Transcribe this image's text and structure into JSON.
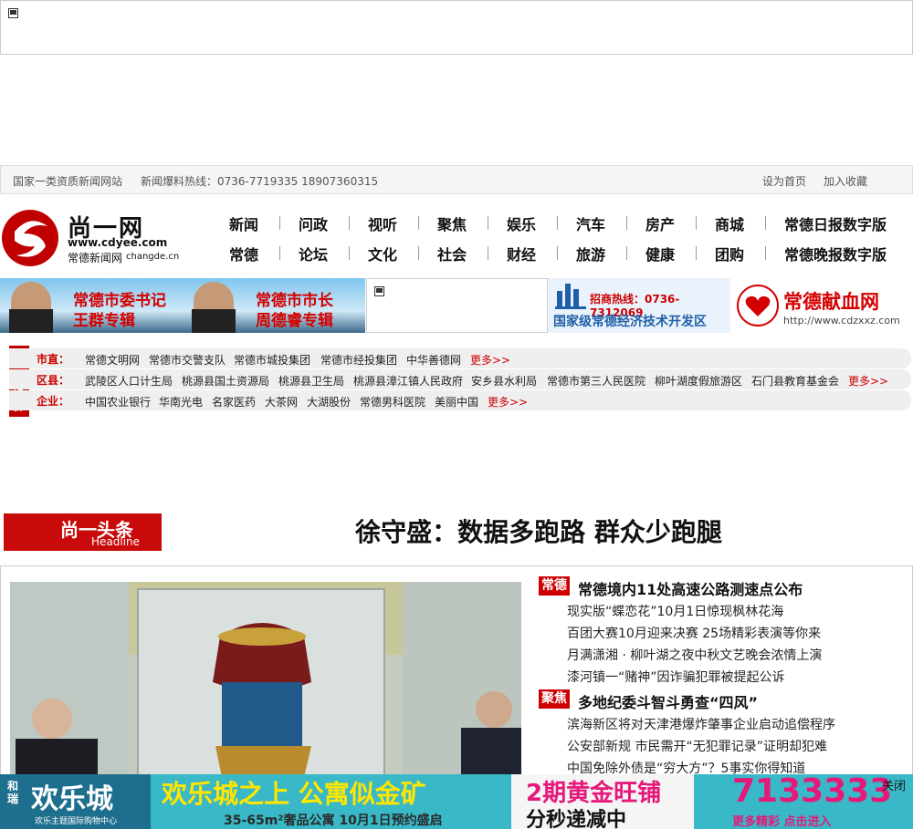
{
  "topbar": {
    "site_type": "国家一类资质新闻网站",
    "hotline": "新闻爆料热线：0736-7719335 18907360315",
    "set_home": "设为首页",
    "bookmark": "加入收藏"
  },
  "logo": {
    "name": "尚一网",
    "domain": "www.cdyee.com",
    "subtitle": "常德新闻网",
    "sub_domain": "changde.cn"
  },
  "nav": {
    "row1": [
      "新闻",
      "问政",
      "视听",
      "聚焦",
      "娱乐",
      "汽车",
      "房产",
      "商城",
      "常德日报数字版"
    ],
    "row2": [
      "常德",
      "论坛",
      "文化",
      "社会",
      "财经",
      "旅游",
      "健康",
      "团购",
      "常德晚报数字版"
    ]
  },
  "banners": {
    "secretary": {
      "title": "常德市委书记",
      "name": "王群专辑"
    },
    "mayor": {
      "title": "常德市市长",
      "name": "周德睿专辑"
    },
    "devzone": {
      "hotline": "招商热线：0736-7312069",
      "name": "国家级常德经济技术开发区"
    },
    "blood": {
      "name": "常德献血网",
      "url": "http://www.cdzxxz.com"
    }
  },
  "network": {
    "side_label": "尚一网络群",
    "rows": [
      {
        "label": "市直：",
        "items": [
          "常德文明网",
          "常德市交警支队",
          "常德市城投集团",
          "常德市经投集团",
          "中华善德网"
        ],
        "more": "更多>>"
      },
      {
        "label": "区县：",
        "items": [
          "武陵区人口计生局",
          "桃源县国土资源局",
          "桃源县卫生局",
          "桃源县漳江镇人民政府",
          "安乡县水利局",
          "常德市第三人民医院",
          "柳叶湖度假旅游区",
          "石门县教育基金会"
        ],
        "more": "更多>>"
      },
      {
        "label": "企业：",
        "items": [
          "中国农业银行",
          "华南光电",
          "名家医药",
          "大茶网",
          "大湖股份",
          "常德男科医院",
          "美丽中国"
        ],
        "more": "更多>>"
      }
    ]
  },
  "headline": {
    "tag_cn": "尚一头条",
    "tag_en": "Headline",
    "title": "徐守盛：数据多跑路 群众少跑腿"
  },
  "news": {
    "groups": [
      {
        "tag": "常德",
        "title": "常德境内11处高速公路测速点公布",
        "items": [
          "现实版“蝶恋花”10月1日惊现枫林花海",
          "百团大赛10月迎来决赛 25场精彩表演等你来",
          "月满潇湘 · 柳叶湖之夜中秋文艺晚会浓情上演",
          "漆河镇一“赌神”因诈骗犯罪被提起公诉"
        ]
      },
      {
        "tag": "聚焦",
        "title": "多地纪委斗智斗勇查“四风”",
        "items": [
          "滨海新区将对天津港爆炸肇事企业启动追偿程序",
          "公安部新规 市民需开“无犯罪记录”证明却犯难",
          "中国免除外债是“穷大方”？5事实你得知道"
        ]
      }
    ]
  },
  "ad": {
    "brand_small": "和瑞",
    "brand": "欢乐城",
    "brand_sub": "欢乐主题国际购物中心",
    "slogan": "欢乐城之上 公寓似金矿",
    "detail": "35-65m²奢品公寓 10月1日预约盛启",
    "phase": "2期黄金旺铺",
    "phase_sub": "分秒递减中",
    "phone": "7133333",
    "more": "更多精彩 点击进入",
    "close": "关闭"
  },
  "colors": {
    "brand_red": "#c00000",
    "ad_bg": "#39b9c7",
    "ad_text": "#ffe600"
  }
}
